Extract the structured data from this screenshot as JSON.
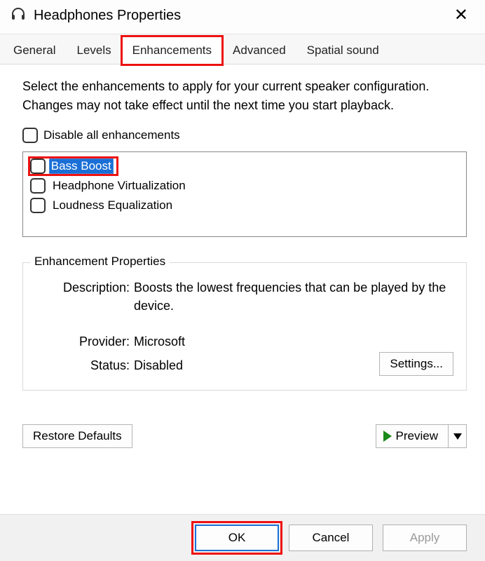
{
  "window": {
    "title": "Headphones Properties"
  },
  "tabs": [
    "General",
    "Levels",
    "Enhancements",
    "Advanced",
    "Spatial sound"
  ],
  "active_tab_index": 2,
  "intro": "Select the enhancements to apply for your current speaker configuration. Changes may not take effect until the next time you start playback.",
  "disable_all": {
    "label": "Disable all enhancements",
    "checked": false
  },
  "enhancements": [
    {
      "label": "Bass Boost",
      "checked": false,
      "selected": true
    },
    {
      "label": "Headphone Virtualization",
      "checked": false,
      "selected": false
    },
    {
      "label": "Loudness Equalization",
      "checked": false,
      "selected": false
    }
  ],
  "properties": {
    "legend": "Enhancement Properties",
    "description_label": "Description:",
    "description": "Boosts the lowest frequencies that can be played by the device.",
    "provider_label": "Provider:",
    "provider": "Microsoft",
    "status_label": "Status:",
    "status": "Disabled",
    "settings_button": "Settings..."
  },
  "restore_button": "Restore Defaults",
  "preview_button": "Preview",
  "dialog_buttons": {
    "ok": "OK",
    "cancel": "Cancel",
    "apply": "Apply"
  }
}
